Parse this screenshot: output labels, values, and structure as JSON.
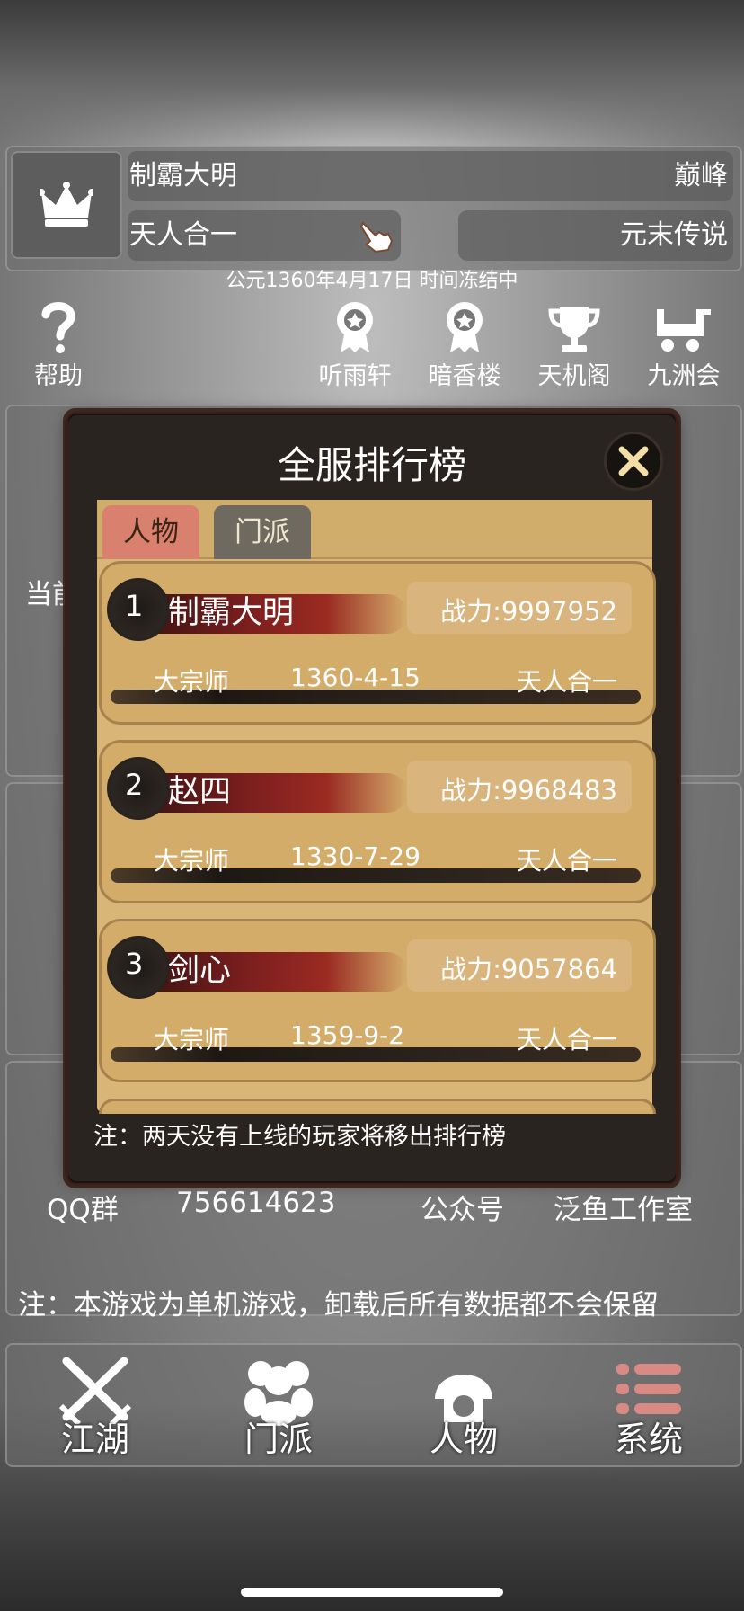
{
  "player": {
    "name": "制霸大明",
    "rank_tier": "巅峰",
    "realm": "天人合一",
    "title": "元末传说"
  },
  "date_line": "公元1360年4月17日 时间冻结中",
  "nav": {
    "help": "帮助",
    "items": [
      "听雨轩",
      "暗香楼",
      "天机阁",
      "九洲会"
    ]
  },
  "background": {
    "current_label": "当前",
    "contact": {
      "qq_label": "QQ群",
      "qq_value": "756614623",
      "wechat_label": "公众号",
      "wechat_value": "泛鱼工作室"
    },
    "footer_note": "注：本游戏为单机游戏，卸载后所有数据都不会保留"
  },
  "bottom_tabs": [
    "江湖",
    "门派",
    "人物",
    "系统"
  ],
  "modal": {
    "title": "全服排行榜",
    "tabs": [
      "人物",
      "门派"
    ],
    "entries": [
      {
        "rank": "1",
        "name": "制霸大明",
        "power": "战力:9997952",
        "grade": "大宗师",
        "date": "1360-4-15",
        "realm": "天人合一"
      },
      {
        "rank": "2",
        "name": "赵四",
        "power": "战力:9968483",
        "grade": "大宗师",
        "date": "1330-7-29",
        "realm": "天人合一"
      },
      {
        "rank": "3",
        "name": "剑心",
        "power": "战力:9057864",
        "grade": "大宗师",
        "date": "1359-9-2",
        "realm": "天人合一"
      }
    ],
    "note": "注：两天没有上线的玩家将移出排行榜"
  },
  "colors": {
    "active_tab": "#d9806e",
    "inactive_tab": "#6e6a60",
    "card_bg": "#d4ac6a",
    "brush_red": "#9a2a22"
  }
}
